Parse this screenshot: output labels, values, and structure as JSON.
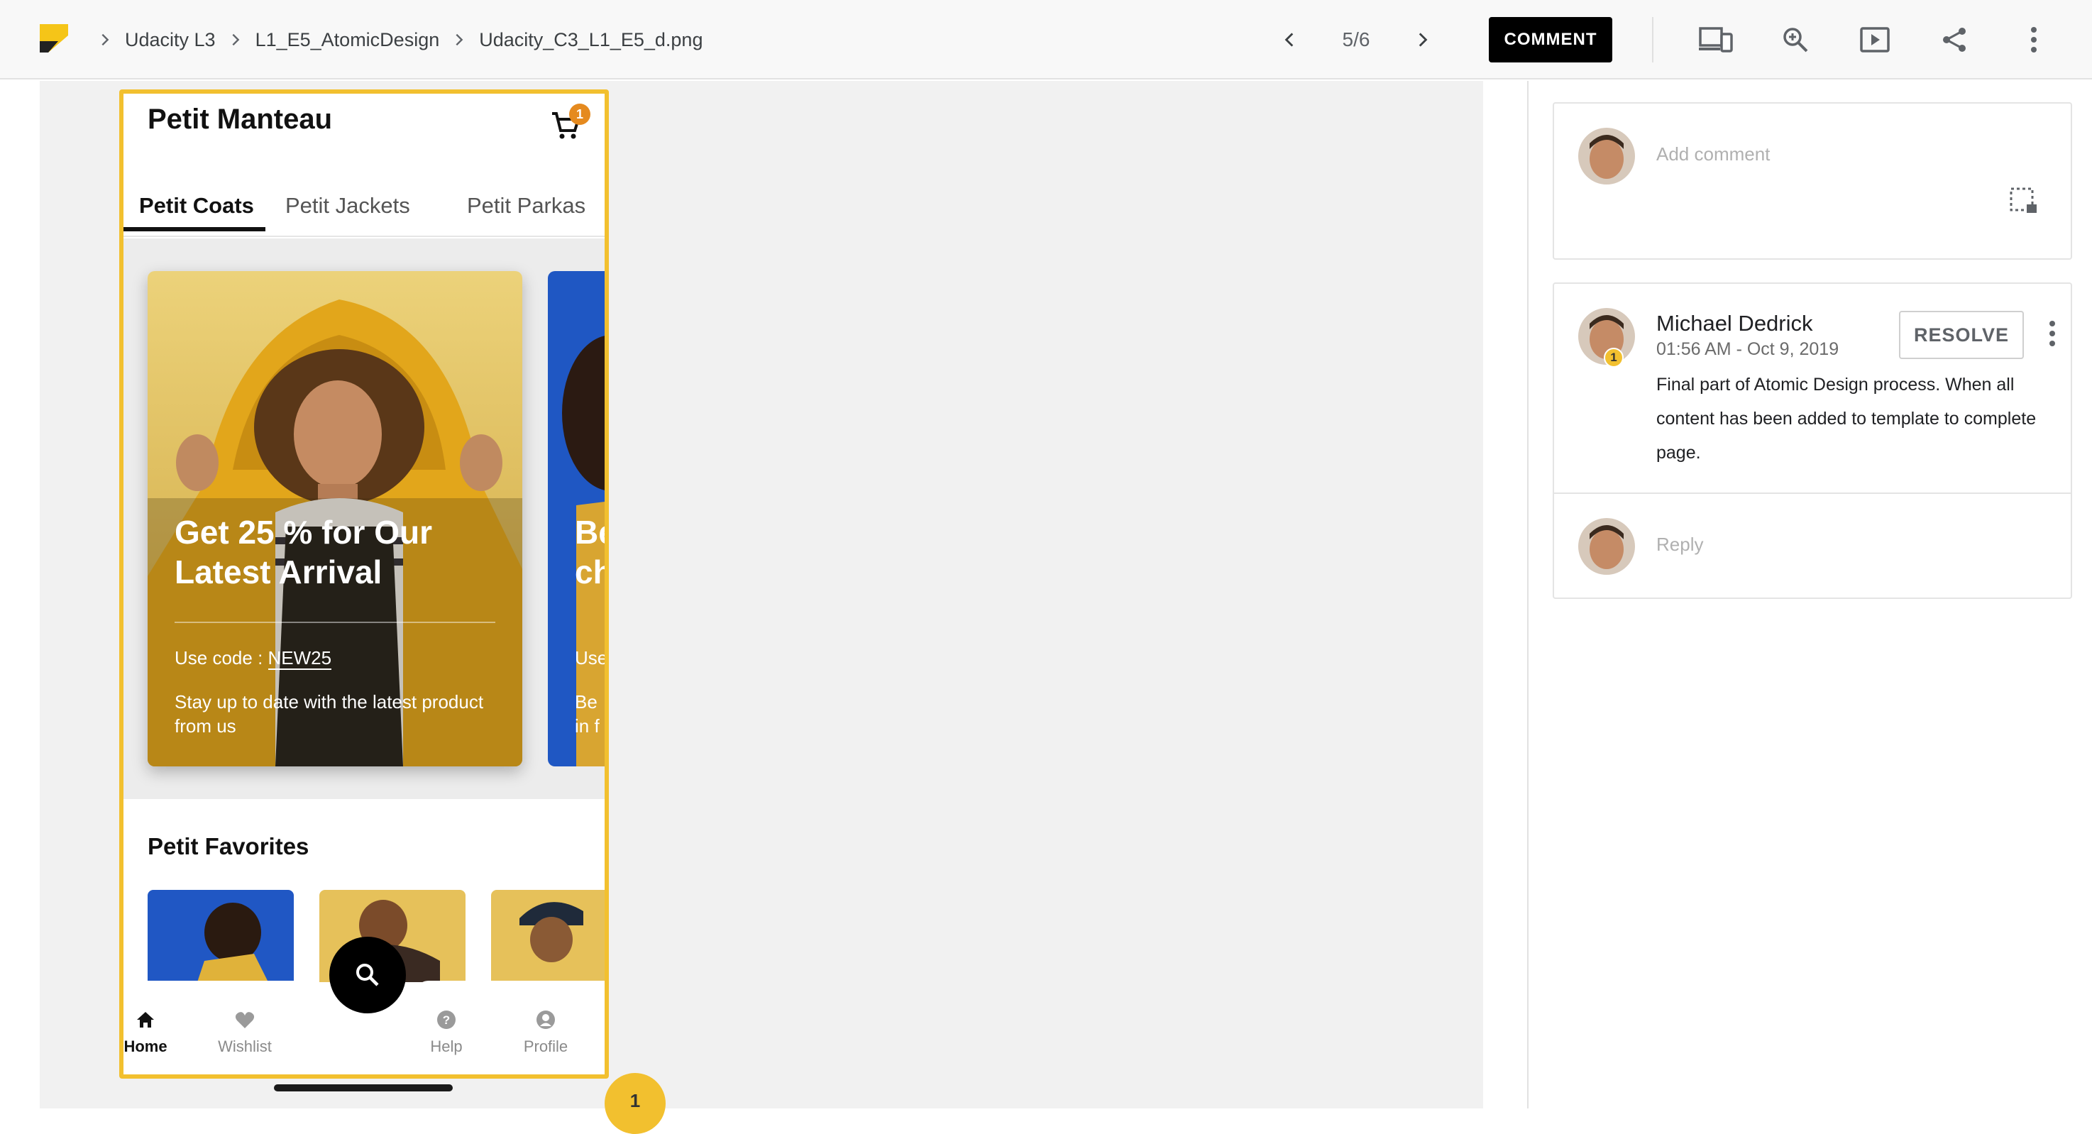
{
  "breadcrumb": {
    "items": [
      "Udacity L3",
      "L1_E5_AtomicDesign",
      "Udacity_C3_L1_E5_d.png"
    ]
  },
  "pager": {
    "count": "5/6"
  },
  "toolbar": {
    "comment_label": "COMMENT",
    "icons": [
      "devices-icon",
      "zoom-in-icon",
      "present-icon",
      "share-icon",
      "more-vert-icon"
    ]
  },
  "app": {
    "title": "Petit Manteau",
    "cart_badge": "1",
    "tabs": [
      "Petit Coats",
      "Petit Jackets",
      "Petit Parkas"
    ],
    "card1": {
      "headline_1": "Get 25 % for Our",
      "headline_2": "Latest Arrival",
      "code_label": "Use code : ",
      "code": "NEW25",
      "desc": "Stay up to date with the latest product from us"
    },
    "card2": {
      "headline_1": "Be",
      "headline_2": "ch",
      "code_label": "Use",
      "desc_1": "Be",
      "desc_2": "in f"
    },
    "favorites_title": "Petit Favorites",
    "nav": [
      "Home",
      "Wishlist",
      "Help",
      "Profile"
    ],
    "pin_number": "1"
  },
  "comments": {
    "add_placeholder": "Add comment",
    "thread": {
      "author": "Michael Dedrick",
      "timestamp": "01:56 AM - Oct 9, 2019",
      "badge": "1",
      "body": "Final part of Atomic Design process. When all content has been added to template to complete page.",
      "resolve_label": "RESOLVE"
    },
    "reply_placeholder": "Reply"
  },
  "colors": {
    "accent_yellow": "#f2c02f",
    "badge_orange": "#e58a1f",
    "card_yellow": "#e7c24a",
    "card_blue": "#1f57c3"
  }
}
